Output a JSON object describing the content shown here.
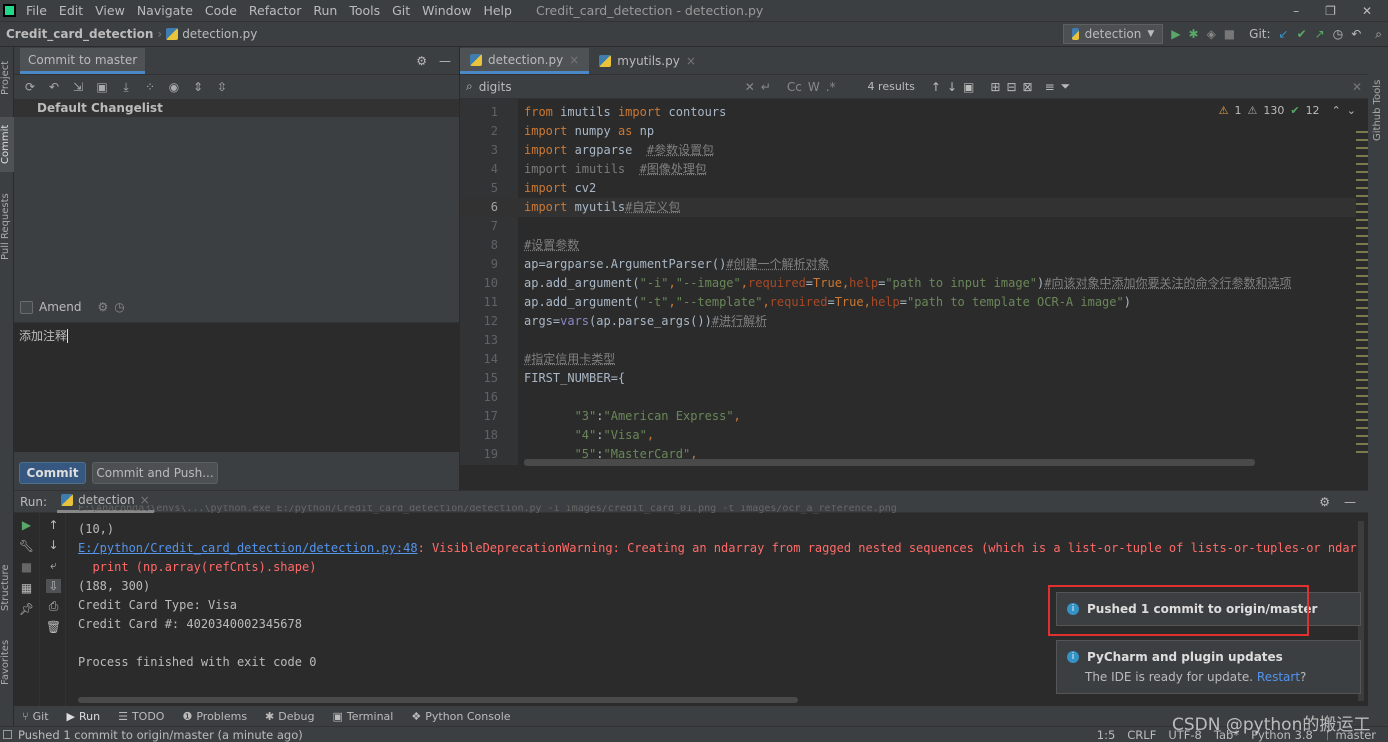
{
  "menu": [
    "File",
    "Edit",
    "View",
    "Navigate",
    "Code",
    "Refactor",
    "Run",
    "Tools",
    "Git",
    "Window",
    "Help"
  ],
  "window_title": "Credit_card_detection - detection.py",
  "breadcrumb": {
    "project": "Credit_card_detection",
    "file": "detection.py"
  },
  "run_config": "detection",
  "git_label": "Git:",
  "left_tabs": [
    "Project",
    "Commit",
    "Pull Requests",
    "Structure",
    "Favorites"
  ],
  "right_tabs": [
    "Github Tools"
  ],
  "commit": {
    "tab": "Commit to master",
    "changelist": "Default Changelist",
    "amend": "Amend",
    "amend_checked": false,
    "message": "添加注释",
    "commit_button": "Commit",
    "commit_push_button": "Commit and Push..."
  },
  "editor": {
    "tabs": [
      {
        "label": "detection.py",
        "active": true
      },
      {
        "label": "myutils.py",
        "active": false
      }
    ],
    "search": {
      "value": "digits",
      "results": "4 results",
      "cc": "Cc",
      "w": "W"
    },
    "inspections": {
      "errors": "1",
      "warnings": "130",
      "ok": "12"
    },
    "current_line": 6,
    "lines": [
      [
        [
          "from",
          "k"
        ],
        [
          " imutils ",
          "n"
        ],
        [
          "import",
          "k"
        ],
        [
          " contours",
          "n"
        ]
      ],
      [
        [
          "import",
          "k"
        ],
        [
          " numpy ",
          "n"
        ],
        [
          "as",
          "k"
        ],
        [
          " np",
          "n"
        ]
      ],
      [
        [
          "import",
          "k"
        ],
        [
          " argparse  ",
          "n"
        ],
        [
          "#参数设置包",
          "c"
        ]
      ],
      [
        [
          "import imutils  ",
          "g"
        ],
        [
          "#图像处理包",
          "c"
        ]
      ],
      [
        [
          "import",
          "k"
        ],
        [
          " cv2",
          "n"
        ]
      ],
      [
        [
          "import",
          "k"
        ],
        [
          " myutils",
          "n"
        ],
        [
          "#自定义包",
          "c"
        ]
      ],
      [],
      [
        [
          "#设置参数",
          "c"
        ]
      ],
      [
        [
          "ap=argparse.ArgumentParser()",
          "n"
        ],
        [
          "#创建一个解析对象",
          "c"
        ]
      ],
      [
        [
          "ap.add_argument(",
          "n"
        ],
        [
          "\"-i\"",
          "s"
        ],
        [
          ",",
          "k"
        ],
        [
          "\"--image\"",
          "s"
        ],
        [
          ",",
          "k"
        ],
        [
          "required",
          "p"
        ],
        [
          "=",
          "n"
        ],
        [
          "True",
          "k"
        ],
        [
          ",",
          "k"
        ],
        [
          "help",
          "p"
        ],
        [
          "=",
          "n"
        ],
        [
          "\"path to input image\"",
          "s"
        ],
        [
          ")",
          "n"
        ],
        [
          "#向该对象中添加你要关注的命令行参数和选项",
          "c"
        ]
      ],
      [
        [
          "ap.add_argument(",
          "n"
        ],
        [
          "\"-t\"",
          "s"
        ],
        [
          ",",
          "k"
        ],
        [
          "\"--template\"",
          "s"
        ],
        [
          ",",
          "k"
        ],
        [
          "required",
          "p"
        ],
        [
          "=",
          "n"
        ],
        [
          "True",
          "k"
        ],
        [
          ",",
          "k"
        ],
        [
          "help",
          "p"
        ],
        [
          "=",
          "n"
        ],
        [
          "\"path to template OCR-A image\"",
          "s"
        ],
        [
          ")",
          "n"
        ]
      ],
      [
        [
          "args=",
          "n"
        ],
        [
          "vars",
          "b"
        ],
        [
          "(ap.parse_args())",
          "n"
        ],
        [
          "#进行解析",
          "c"
        ]
      ],
      [],
      [
        [
          "#指定信用卡类型",
          "c"
        ]
      ],
      [
        [
          "FIRST_NUMBER={",
          "n"
        ]
      ],
      [],
      [
        [
          "       ",
          "n"
        ],
        [
          "\"3\"",
          "s"
        ],
        [
          ":",
          "n"
        ],
        [
          "\"American Express\"",
          "s"
        ],
        [
          ",",
          "k"
        ]
      ],
      [
        [
          "       ",
          "n"
        ],
        [
          "\"4\"",
          "s"
        ],
        [
          ":",
          "n"
        ],
        [
          "\"Visa\"",
          "s"
        ],
        [
          ",",
          "k"
        ]
      ],
      [
        [
          "       ",
          "n"
        ],
        [
          "\"5\"",
          "s"
        ],
        [
          ":",
          "n"
        ],
        [
          "\"MasterCard\"",
          "s"
        ],
        [
          ",",
          "k"
        ]
      ]
    ]
  },
  "run": {
    "label": "Run:",
    "tab": "detection",
    "output": [
      {
        "text": "(10,)",
        "type": "normal"
      },
      {
        "link": "E:/python/Credit_card_detection/detection.py:48",
        "text": ": VisibleDeprecationWarning: Creating an ndarray from ragged nested sequences (which is a list-or-tuple of lists-or-tuples-or ndarr",
        "type": "error"
      },
      {
        "text": "  print (np.array(refCnts).shape)",
        "type": "error"
      },
      {
        "text": "(188, 300)",
        "type": "normal"
      },
      {
        "text": "Credit Card Type: Visa",
        "type": "normal"
      },
      {
        "text": "Credit Card #: 4020340002345678",
        "type": "normal"
      },
      {
        "text": "",
        "type": "normal"
      },
      {
        "text": "Process finished with exit code 0",
        "type": "normal"
      }
    ]
  },
  "notifications": [
    {
      "title": "Pushed 1 commit to origin/master",
      "body": "",
      "highlighted": true
    },
    {
      "title": "PyCharm and plugin updates",
      "body": "The IDE is ready for update.",
      "link": "Restart",
      "suffix": "?"
    }
  ],
  "toolwindows": [
    "Git",
    "Run",
    "TODO",
    "Problems",
    "Debug",
    "Terminal",
    "Python Console"
  ],
  "status": {
    "message": "Pushed 1 commit to origin/master (a minute ago)",
    "position": "1:5",
    "line_sep": "CRLF",
    "encoding": "UTF-8",
    "indent": "Tab*",
    "interpreter": "Python 3.8",
    "branch": "master"
  },
  "watermark": "CSDN @python的搬运工",
  "colors": {
    "accent": "#4a88c7",
    "highlight_box": "#e0302f",
    "keyword": "#cc7832",
    "string": "#6a8759",
    "error": "#ff6b68",
    "link": "#5394ec"
  }
}
